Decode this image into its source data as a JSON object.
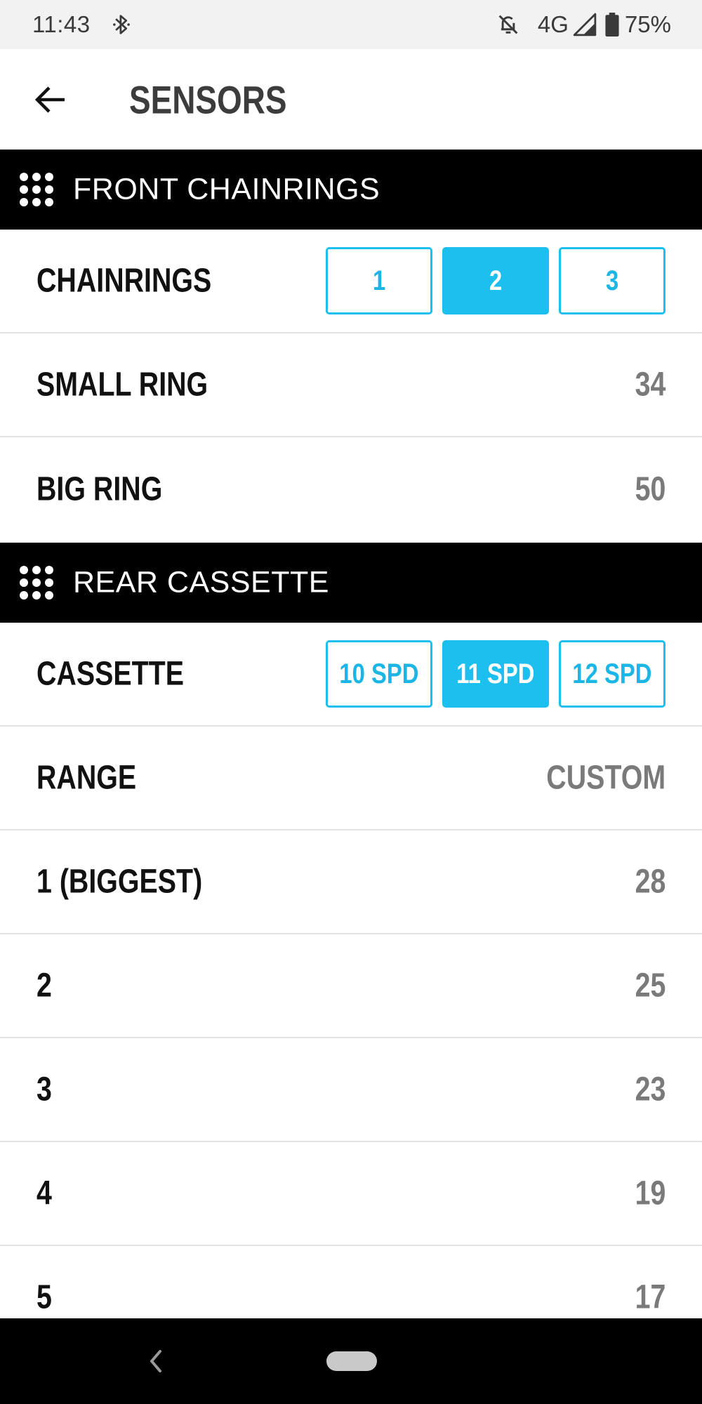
{
  "status_bar": {
    "time": "11:43",
    "network": "4G",
    "battery": "75%",
    "icons": [
      "bluetooth-icon",
      "mute-icon",
      "signal-icon",
      "battery-icon"
    ]
  },
  "app_bar": {
    "title": "SENSORS",
    "back_icon": "arrow-left-icon"
  },
  "front": {
    "header": "FRONT CHAINRINGS",
    "chainrings": {
      "label": "CHAINRINGS",
      "options": [
        "1",
        "2",
        "3"
      ],
      "selected": "2"
    },
    "small_ring": {
      "label": "SMALL RING",
      "value": "34"
    },
    "big_ring": {
      "label": "BIG RING",
      "value": "50"
    }
  },
  "rear": {
    "header": "REAR CASSETTE",
    "cassette": {
      "label": "CASSETTE",
      "options": [
        "10 SPD",
        "11 SPD",
        "12 SPD"
      ],
      "selected": "11 SPD"
    },
    "range": {
      "label": "RANGE",
      "value": "CUSTOM"
    },
    "cogs": [
      {
        "label": "1 (BIGGEST)",
        "value": "28"
      },
      {
        "label": "2",
        "value": "25"
      },
      {
        "label": "3",
        "value": "23"
      },
      {
        "label": "4",
        "value": "19"
      },
      {
        "label": "5",
        "value": "17"
      }
    ]
  },
  "colors": {
    "accent": "#1cbfed",
    "header_bg": "#000000",
    "value_text": "#7a7a7a"
  }
}
